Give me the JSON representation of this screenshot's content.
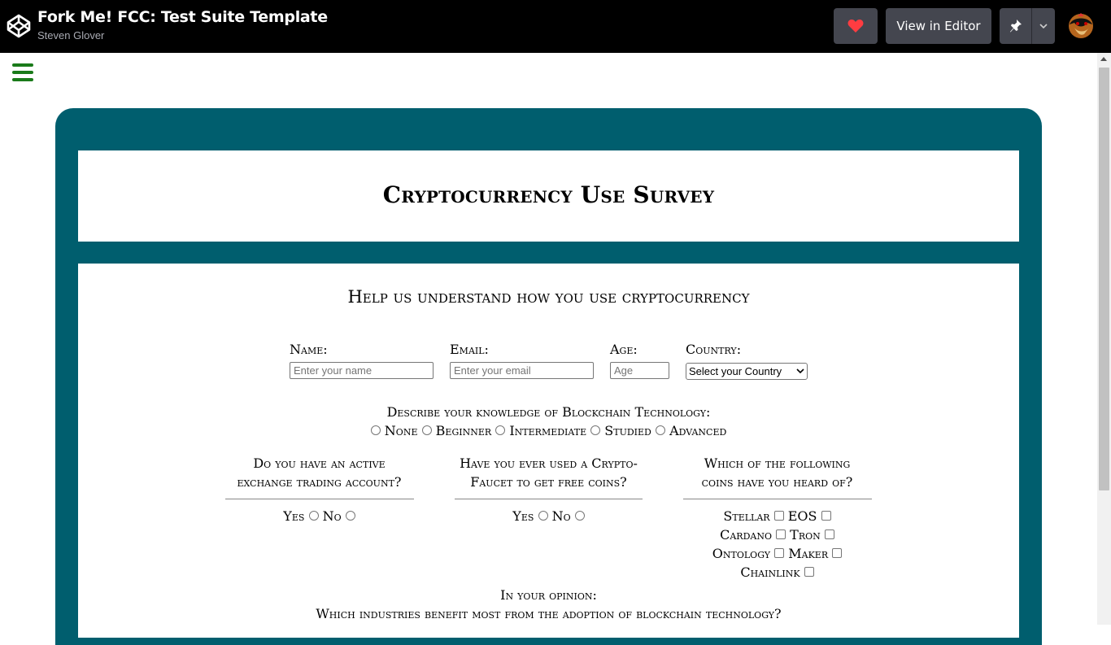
{
  "topbar": {
    "title": "Fork Me! FCC: Test Suite Template",
    "author": "Steven Glover",
    "view_editor_label": "View in Editor",
    "icons": [
      "codepen-logo-icon",
      "heart-icon",
      "pin-icon",
      "chevron-down-icon",
      "avatar"
    ]
  },
  "colors": {
    "accent": "#005e6e",
    "heart": "#ff3c41",
    "menu": "#1a7a1a"
  },
  "survey": {
    "title": "Cryptocurrency Use Survey",
    "subtitle": "Help us understand how you use cryptocurrency",
    "fields": {
      "name_label": "Name:",
      "name_placeholder": "Enter your name",
      "email_label": "Email:",
      "email_placeholder": "Enter your email",
      "age_label": "Age:",
      "age_placeholder": "Age",
      "country_label": "Country:",
      "country_selected": "Select your Country"
    },
    "knowledge": {
      "question": "Describe your knowledge of Blockchain Technology:",
      "options": [
        "None",
        "Beginner",
        "Intermediate",
        "Studied",
        "Advanced"
      ]
    },
    "q_exchange": {
      "line1": "Do you have an active",
      "line2": "exchange trading account?",
      "yes": "Yes",
      "no": "No"
    },
    "q_faucet": {
      "line1": "Have you ever used a Crypto-",
      "line2": "Faucet to get free coins?",
      "yes": "Yes",
      "no": "No"
    },
    "q_coins": {
      "line1": "Which of the following",
      "line2": "coins have you heard of?",
      "coins": [
        "Stellar",
        "EOS",
        "Cardano",
        "Tron",
        "Ontology",
        "Maker",
        "Chainlink"
      ]
    },
    "opinion": {
      "line1": "In your opinion:",
      "line2": "Which industries benefit most from the adoption of blockchain technology?"
    }
  }
}
